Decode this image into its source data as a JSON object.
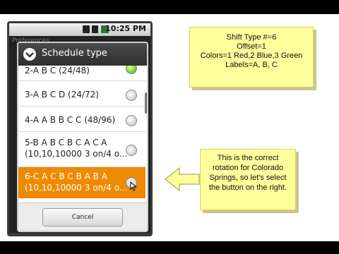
{
  "status_bar": {
    "time": "10:25 PM"
  },
  "background_title": "Preferences",
  "dialog": {
    "title": "Schedule type",
    "items": [
      {
        "lines": [
          "2-A B C (24/48)"
        ],
        "selected": false
      },
      {
        "lines": [
          "3-A B C D (24/72)"
        ],
        "selected": false
      },
      {
        "lines": [
          "4-A A B B C C (48/96)"
        ],
        "selected": false
      },
      {
        "lines": [
          "5-B A B C B C A C A",
          "(10,10,10000 3 on/4 o..."
        ],
        "selected": false
      },
      {
        "lines": [
          "6-C A C B C B A B A",
          "(10,10,10000 3 on/4 o..."
        ],
        "selected": true
      }
    ],
    "cancel_label": "Cancel"
  },
  "note_info": {
    "lines": [
      "Shift Type #=6",
      "Offset=1",
      "Colors=1 Red,2 Blue,3 Green",
      "Labels=A, B, C"
    ]
  },
  "note_pointer": {
    "text": "This is the correct rotation for Colorado Springs, so let's select the button on the right."
  },
  "colors": {
    "selected_row": "#ee8a00",
    "note_bg": "#fffe9c"
  }
}
